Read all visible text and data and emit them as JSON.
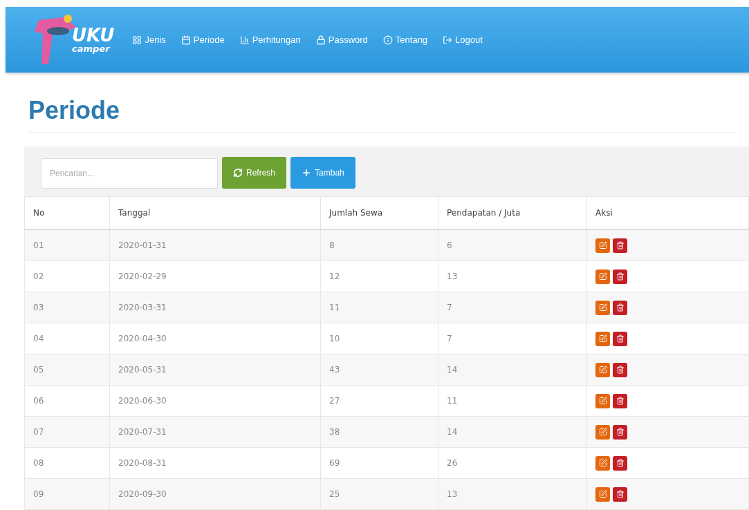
{
  "brand": {
    "title": "UKU",
    "subtitle": "camper"
  },
  "nav": [
    {
      "label": "Jenis"
    },
    {
      "label": "Periode"
    },
    {
      "label": "Perhitungan"
    },
    {
      "label": "Password"
    },
    {
      "label": "Tentang"
    },
    {
      "label": "Logout"
    }
  ],
  "page_title": "Periode",
  "search": {
    "placeholder": "Pencarian..."
  },
  "buttons": [
    {
      "kind": "refresh",
      "label": "Refresh"
    },
    {
      "kind": "add",
      "label": "Tambah"
    }
  ],
  "table": {
    "columns": [
      "No",
      "Tanggal",
      "Jumlah Sewa",
      "Pendapatan / Juta",
      "Aksi"
    ],
    "rows": [
      [
        "01",
        "2020-01-31",
        "8",
        "6"
      ],
      [
        "02",
        "2020-02-29",
        "12",
        "13"
      ],
      [
        "03",
        "2020-03-31",
        "11",
        "7"
      ],
      [
        "04",
        "2020-04-30",
        "10",
        "7"
      ],
      [
        "05",
        "2020-05-31",
        "43",
        "14"
      ],
      [
        "06",
        "2020-06-30",
        "27",
        "11"
      ],
      [
        "07",
        "2020-07-31",
        "38",
        "14"
      ],
      [
        "08",
        "2020-08-31",
        "69",
        "26"
      ],
      [
        "09",
        "2020-09-30",
        "25",
        "13"
      ]
    ]
  }
}
